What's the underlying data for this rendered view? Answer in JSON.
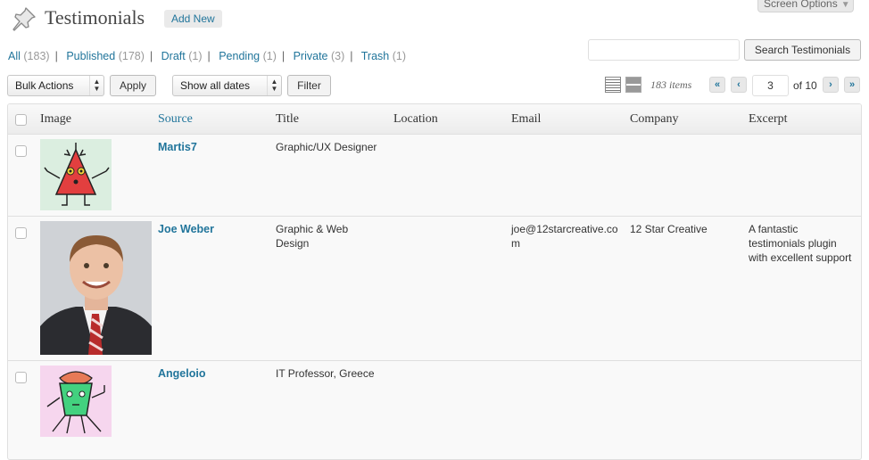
{
  "header": {
    "title": "Testimonials",
    "add_new": "Add New",
    "screen_options": "Screen Options"
  },
  "status_links": [
    {
      "label": "All",
      "count": "(183)"
    },
    {
      "label": "Published",
      "count": "(178)"
    },
    {
      "label": "Draft",
      "count": "(1)"
    },
    {
      "label": "Pending",
      "count": "(1)"
    },
    {
      "label": "Private",
      "count": "(3)"
    },
    {
      "label": "Trash",
      "count": "(1)"
    }
  ],
  "search": {
    "value": "",
    "button": "Search Testimonials"
  },
  "tablenav": {
    "bulk_actions": "Bulk Actions",
    "apply": "Apply",
    "dates": "Show all dates",
    "filter": "Filter",
    "items": "183 items",
    "first": "«",
    "prev": "‹",
    "next": "›",
    "last": "»",
    "current_page": "3",
    "of_pages": "of 10"
  },
  "columns": [
    "Image",
    "Source",
    "Title",
    "Location",
    "Email",
    "Company",
    "Excerpt"
  ],
  "rows": [
    {
      "source": "Martis7",
      "title": "Graphic/UX Designer",
      "location": "",
      "email": "",
      "company": "",
      "excerpt": ""
    },
    {
      "source": "Joe Weber",
      "title": "Graphic & Web Design",
      "location": "",
      "email": "joe@12starcreative.com",
      "company": "12 Star Creative",
      "excerpt": "A fantastic testimonials plugin with excellent support"
    },
    {
      "source": "Angeloio",
      "title": "IT Professor, Greece",
      "location": "",
      "email": "",
      "company": "",
      "excerpt": ""
    }
  ],
  "colors": {
    "link": "#21759b",
    "border": "#dfdfdf",
    "row_bg": "#f9f9f9"
  }
}
